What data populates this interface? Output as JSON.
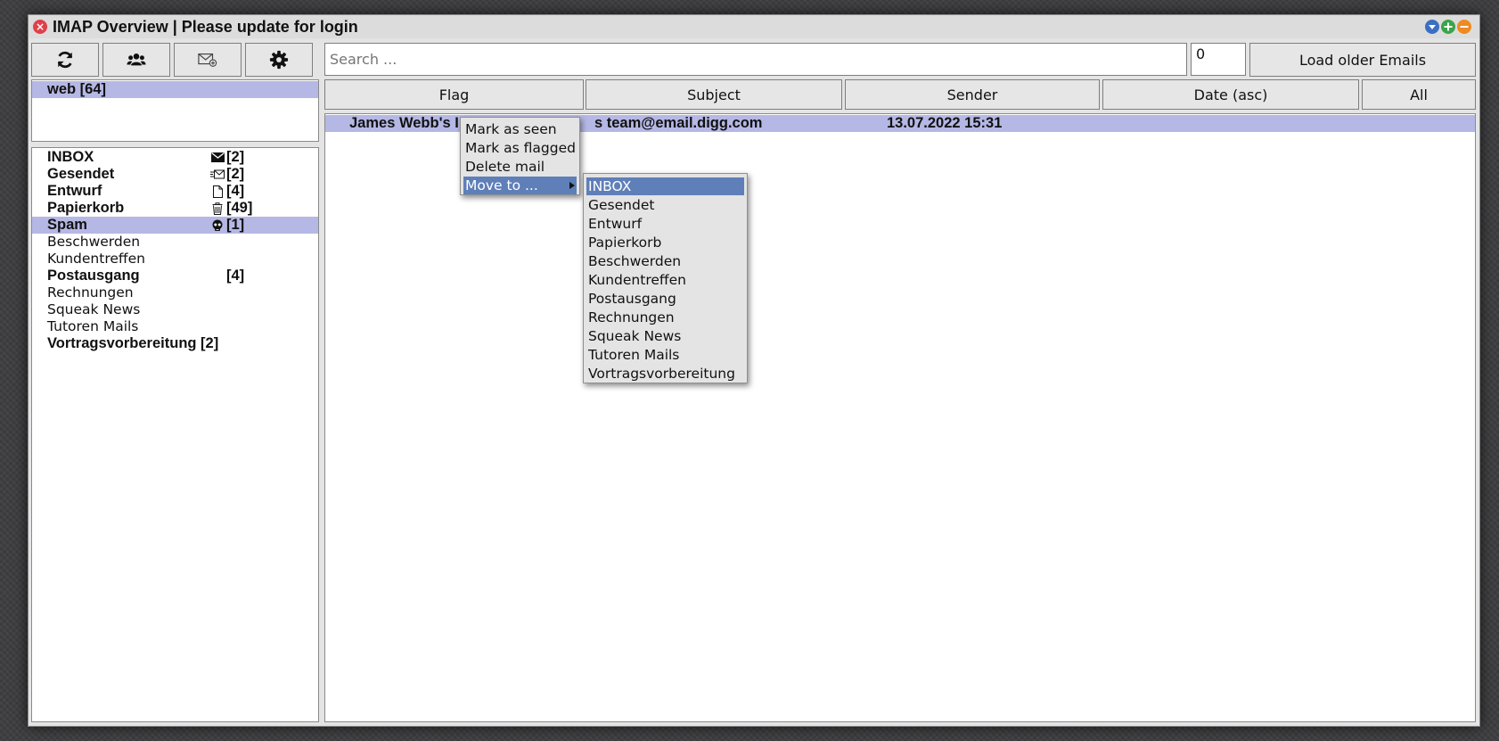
{
  "window": {
    "title": "IMAP Overview | Please update for login",
    "controls": {
      "close": "close-icon",
      "collapse": "triangle-down-icon",
      "maximize": "plus-icon",
      "minimize": "minus-icon"
    }
  },
  "toolbar": {
    "refresh_icon": "refresh-icon",
    "contacts_icon": "users-icon",
    "compose_icon": "compose-mail-icon",
    "settings_icon": "gear-icon",
    "search_placeholder": "Search ...",
    "count_value": "0",
    "load_older_label": "Load older Emails"
  },
  "accounts": [
    {
      "label": "web [64]",
      "selected": true
    }
  ],
  "folders": [
    {
      "name": "INBOX",
      "icon": "envelope-icon",
      "count": "[2]",
      "bold": true
    },
    {
      "name": "Gesendet",
      "icon": "sent-mail-icon",
      "count": "[2]",
      "bold": true
    },
    {
      "name": "Entwurf",
      "icon": "draft-icon",
      "count": "[4]",
      "bold": true
    },
    {
      "name": "Papierkorb",
      "icon": "trash-icon",
      "count": "[49]",
      "bold": true
    },
    {
      "name": "Spam",
      "icon": "skull-icon",
      "count": "[1]",
      "bold": true,
      "selected": true
    },
    {
      "name": "Beschwerden",
      "icon": "",
      "count": "",
      "bold": false
    },
    {
      "name": "Kundentreffen",
      "icon": "",
      "count": "",
      "bold": false
    },
    {
      "name": "Postausgang",
      "icon": "",
      "count": "[4]",
      "bold": true
    },
    {
      "name": "Rechnungen",
      "icon": "",
      "count": "",
      "bold": false
    },
    {
      "name": "Squeak News",
      "icon": "",
      "count": "",
      "bold": false
    },
    {
      "name": "Tutoren Mails",
      "icon": "",
      "count": "",
      "bold": false
    },
    {
      "name": "Vortragsvorbereitung [2]",
      "icon": "",
      "count": "",
      "bold": true
    }
  ],
  "columns": {
    "flag": "Flag",
    "subject": "Subject",
    "sender": "Sender",
    "date": "Date (asc)",
    "all": "All"
  },
  "emails": [
    {
      "subject_prefix": "James Webb's I",
      "sender_suffix": "s team@email.digg.com",
      "date": "13.07.2022 15:31",
      "selected": true
    }
  ],
  "context_menu": {
    "items": [
      "Mark as seen",
      "Mark as flagged",
      "Delete mail",
      "Move to ..."
    ],
    "highlighted": 3
  },
  "submenu": {
    "items": [
      "INBOX",
      "Gesendet",
      "Entwurf",
      "Papierkorb",
      "Beschwerden",
      "Kundentreffen",
      "Postausgang",
      "Rechnungen",
      "Squeak News",
      "Tutoren Mails",
      "Vortragsvorbereitung"
    ],
    "highlighted": 0
  },
  "colors": {
    "selection": "#b5b8e5",
    "menu_highlight": "#5f7fb8",
    "window_bg": "#e4e4e4"
  }
}
